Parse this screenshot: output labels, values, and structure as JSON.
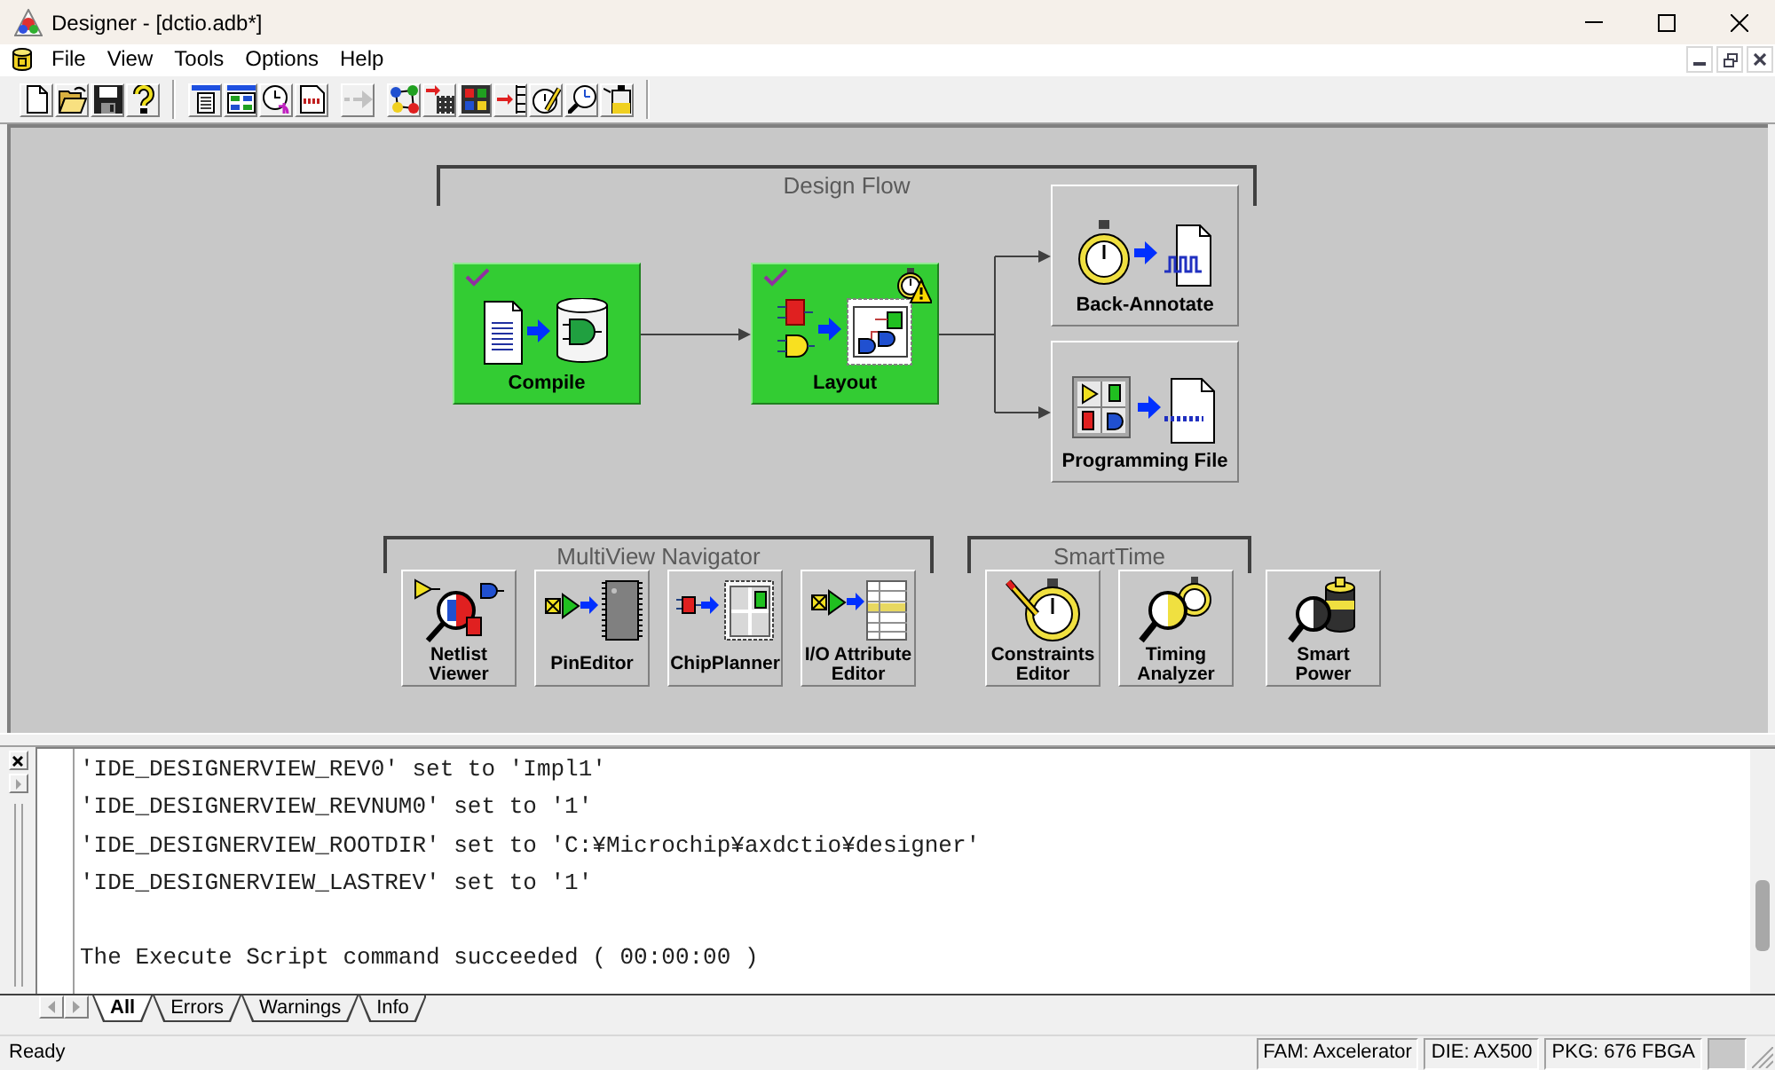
{
  "window": {
    "title": "Designer - [dctio.adb*]"
  },
  "menu": [
    "File",
    "View",
    "Tools",
    "Options",
    "Help"
  ],
  "toolbar": [
    [
      [
        {
          "kind": "new",
          "disabled": false
        },
        {
          "kind": "open",
          "disabled": false
        },
        {
          "kind": "save",
          "disabled": false
        },
        {
          "kind": "help",
          "disabled": false
        }
      ]
    ],
    [
      [
        {
          "kind": "compile",
          "disabled": false
        },
        {
          "kind": "layout",
          "disabled": false
        },
        {
          "kind": "timing",
          "disabled": false
        },
        {
          "kind": "binary",
          "disabled": false
        }
      ],
      [
        {
          "kind": "backannotate",
          "disabled": true
        }
      ],
      [
        {
          "kind": "netlist",
          "disabled": false
        },
        {
          "kind": "pins",
          "disabled": false
        },
        {
          "kind": "chip",
          "disabled": false
        },
        {
          "kind": "io",
          "disabled": false
        },
        {
          "kind": "constraints",
          "disabled": false
        },
        {
          "kind": "analyzer",
          "disabled": false
        },
        {
          "kind": "power",
          "disabled": false
        }
      ]
    ]
  ],
  "design_flow": {
    "title": "Design Flow",
    "steps": [
      {
        "label": "Compile",
        "kind": "compile",
        "done": true,
        "warning": false
      },
      {
        "label": "Layout",
        "kind": "layout",
        "done": true,
        "warning": true
      },
      {
        "label": "Back-Annotate",
        "kind": "backannotate",
        "done": false,
        "warning": false
      },
      {
        "label": "Programming File",
        "kind": "programming",
        "done": false,
        "warning": false
      }
    ]
  },
  "tool_groups": [
    {
      "title": "MultiView Navigator",
      "tools": [
        {
          "label": "Netlist Viewer",
          "kind": "netlist"
        },
        {
          "label": "PinEditor",
          "kind": "pins"
        },
        {
          "label": "ChipPlanner",
          "kind": "chip"
        },
        {
          "label": "I/O Attribute Editor",
          "kind": "io"
        }
      ]
    },
    {
      "title": "SmartTime",
      "tools": [
        {
          "label": "Constraints Editor",
          "kind": "constraints"
        },
        {
          "label": "Timing Analyzer",
          "kind": "analyzer"
        }
      ]
    },
    {
      "tools": [
        {
          "label": "Smart Power",
          "kind": "power"
        }
      ]
    }
  ],
  "log": {
    "blocks": [
      [
        "'IDE_DESIGNERVIEW_REV0' set to 'Impl1'",
        "'IDE_DESIGNERVIEW_REVNUM0' set to '1'",
        "'IDE_DESIGNERVIEW_ROOTDIR' set to 'C:¥Microchip¥axdctio¥designer'",
        "'IDE_DESIGNERVIEW_LASTREV' set to '1'"
      ],
      [
        "The Execute Script command succeeded ( 00:00:00 )"
      ]
    ],
    "tabs": [
      {
        "label": "All",
        "selected": true
      },
      {
        "label": "Errors",
        "selected": false
      },
      {
        "label": "Warnings",
        "selected": false
      },
      {
        "label": "Info",
        "selected": false
      }
    ]
  },
  "status_bar": {
    "message": "Ready",
    "panes": [
      "FAM: Axcelerator",
      "DIE: AX500",
      "PKG: 676 FBGA"
    ]
  }
}
